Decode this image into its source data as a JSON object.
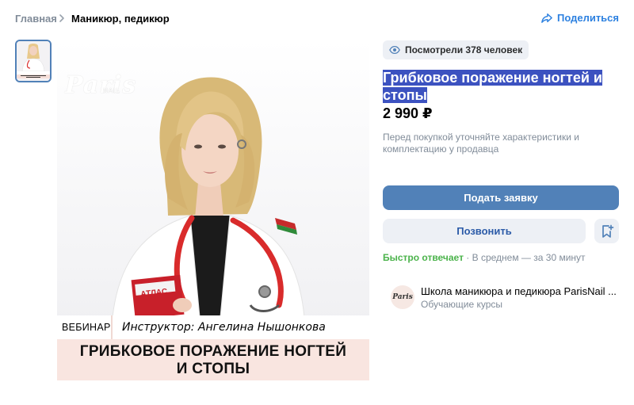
{
  "breadcrumb": {
    "home": "Главная",
    "current": "Маникюр, педикюр"
  },
  "share_label": "Поделиться",
  "image": {
    "brand": "Paris",
    "brand_sub": "NAIL",
    "caption_left": "ВЕБИНАР",
    "caption_right": "Инструктор: Ангелина Нышонкова",
    "caption_title_line1": "ГРИБКОВОЕ ПОРАЖЕНИЕ НОГТЕЙ",
    "caption_title_line2": "И СТОПЫ",
    "book_label": "АТЛАС"
  },
  "product": {
    "views": "Посмотрели 378 человек",
    "title": "Грибковое поражение ногтей и стопы",
    "price": "2 990 ₽",
    "note": "Перед покупкой уточняйте характеристики и комплектацию у продавца"
  },
  "actions": {
    "primary": "Подать заявку",
    "secondary": "Позвонить"
  },
  "response": {
    "fast": "Быстро отвечает",
    "avg": " · В среднем — за 30 минут"
  },
  "seller": {
    "name": "Школа маникюра и педикюра ParisNail ...",
    "category": "Обучающие курсы",
    "avatar_text": "Paris"
  },
  "colors": {
    "accent": "#5181b8",
    "link": "#2d81e0",
    "highlight": "#3c52c0",
    "fast": "#4bb34b"
  }
}
